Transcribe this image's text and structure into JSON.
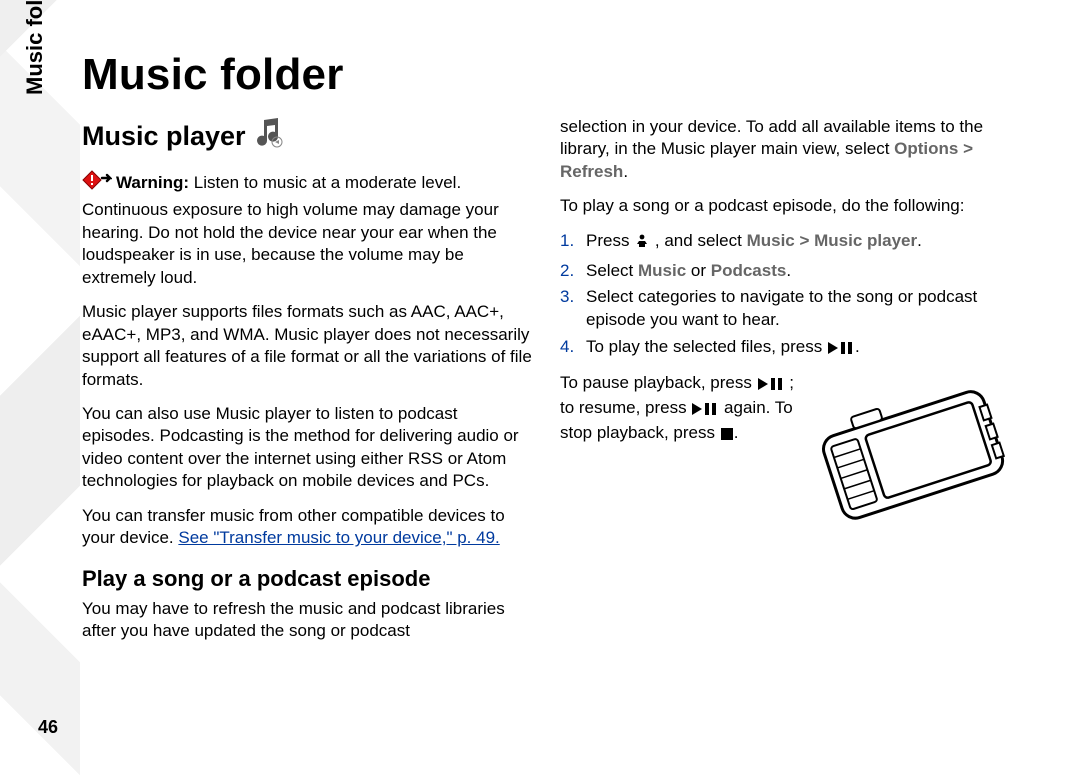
{
  "sidebar_label": "Music folder",
  "page_number": "46",
  "title": "Music folder",
  "left": {
    "section_heading": "Music player",
    "warning_label": "Warning:",
    "warning_text": "  Listen to music at a moderate level. Continuous exposure to high volume may damage your hearing. Do not hold the device near your ear when the loudspeaker is in use, because the volume may be extremely loud.",
    "p2": "Music player supports files formats such as AAC, AAC+, eAAC+, MP3, and WMA. Music player does not necessarily support all features of a file format or all the variations of file formats.",
    "p3": "You can also use Music player to listen to podcast episodes. Podcasting is the method for delivering audio or video content over the internet using either RSS or Atom technologies for playback on mobile devices and PCs.",
    "p4_lead": "You can transfer music from other compatible devices to your device. ",
    "p4_link": "See \"Transfer music to your device,\" p. 49.",
    "subsection": "Play a song or a podcast episode",
    "p5": "You may have to refresh the music and podcast libraries after you have updated the song or podcast"
  },
  "right": {
    "p1a": "selection in your device. To add all available items to the library, in the Music player main view, select ",
    "p1b_menu": "Options > Refresh",
    "p1c": ".",
    "p2": "To play a song or a podcast episode, do the following:",
    "steps": {
      "s1a": "Press ",
      "s1b": " , and select ",
      "s1c_menu": "Music > Music player",
      "s1d": ".",
      "s2a": "Select ",
      "s2b_menu": "Music",
      "s2c": " or ",
      "s2d_menu": "Podcasts",
      "s2e": ".",
      "s3": "Select categories to navigate to the song or podcast episode you want to hear.",
      "s4a": "To play the selected files, press ",
      "s4b": "."
    },
    "p3a": "To pause playback, press ",
    "p3b": " ; to resume, press ",
    "p3c": " again. To stop playback, press ",
    "p3d": "."
  }
}
